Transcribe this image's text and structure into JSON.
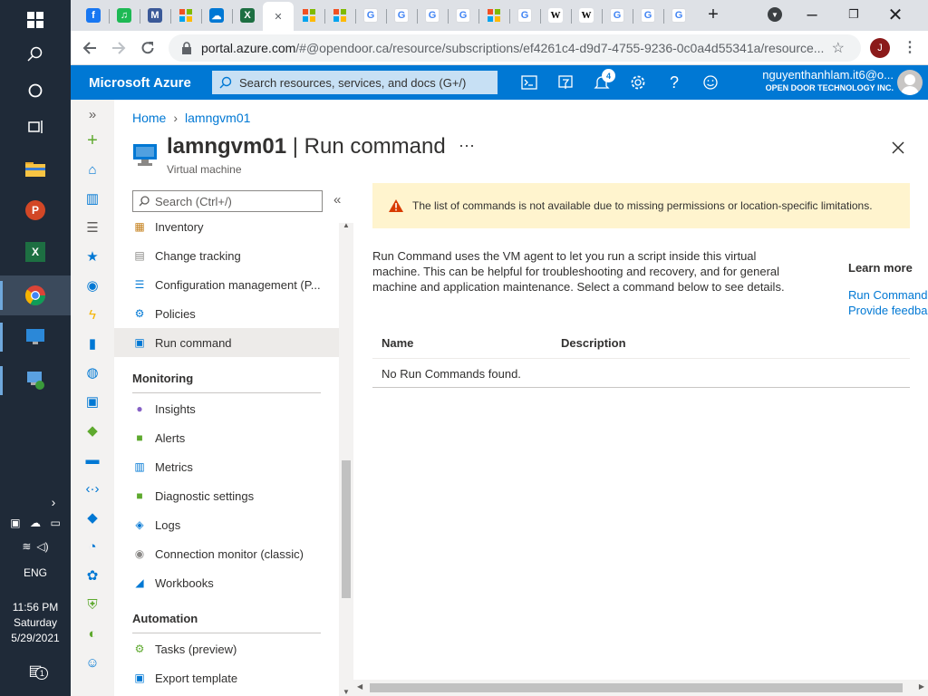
{
  "taskbar": {
    "time": "11:56 PM",
    "day": "Saturday",
    "date": "5/29/2021",
    "language": "ENG",
    "notification_count": "1"
  },
  "browser": {
    "url_host": "portal.azure.com",
    "url_rest": "/#@opendoor.ca/resource/subscriptions/ef4261c4-d9d7-4755-9236-0c0a4d55341a/resource...",
    "profile_initial": "J",
    "tabs": [
      {
        "icon": "facebook-icon",
        "letter": "f",
        "color": "#1877f2"
      },
      {
        "icon": "spotify-icon",
        "letter": "♫",
        "color": "#1db954"
      },
      {
        "icon": "m-icon",
        "letter": "M",
        "color": "#3b5998"
      },
      {
        "icon": "microsoft-icon",
        "letter": "",
        "color": "#f25022"
      },
      {
        "icon": "onedrive-icon",
        "letter": "☁",
        "color": "#0078d4"
      },
      {
        "icon": "excel-icon",
        "letter": "X",
        "color": "#1d6f42"
      },
      {
        "icon": "close-icon",
        "letter": "✕",
        "color": "#5f6368"
      },
      {
        "icon": "microsoft-icon",
        "letter": "",
        "color": "#f25022"
      },
      {
        "icon": "microsoft-icon",
        "letter": "",
        "color": "#f25022"
      },
      {
        "icon": "google-icon",
        "letter": "G",
        "color": "#4285f4"
      },
      {
        "icon": "google-icon",
        "letter": "G",
        "color": "#4285f4"
      },
      {
        "icon": "google-icon",
        "letter": "G",
        "color": "#4285f4"
      },
      {
        "icon": "google-icon",
        "letter": "G",
        "color": "#4285f4"
      },
      {
        "icon": "microsoft-icon",
        "letter": "",
        "color": "#f25022"
      },
      {
        "icon": "google-icon",
        "letter": "G",
        "color": "#4285f4"
      },
      {
        "icon": "wikipedia-icon",
        "letter": "W",
        "color": "#000000"
      },
      {
        "icon": "wikipedia-icon",
        "letter": "W",
        "color": "#000000"
      },
      {
        "icon": "google-icon",
        "letter": "G",
        "color": "#4285f4"
      },
      {
        "icon": "google-icon",
        "letter": "G",
        "color": "#4285f4"
      },
      {
        "icon": "google-icon",
        "letter": "G",
        "color": "#4285f4"
      }
    ]
  },
  "azure": {
    "brand": "Microsoft Azure",
    "search_placeholder": "Search resources, services, and docs (G+/)",
    "notifications": "4",
    "user_email": "nguyenthanhlam.it6@o...",
    "user_org": "OPEN DOOR TECHNOLOGY INC.",
    "accent": "#0078d4"
  },
  "breadcrumb": [
    "Home",
    "lamngvm01"
  ],
  "resource": {
    "name": "lamngvm01",
    "separator": " | ",
    "blade": "Run command",
    "type": "Virtual machine",
    "more": "···"
  },
  "menu": {
    "search_placeholder": "Search (Ctrl+/)",
    "items": [
      {
        "label": "Inventory",
        "icon": "inventory-icon",
        "glyph": "▦",
        "color": "#c47f1a"
      },
      {
        "label": "Change tracking",
        "icon": "change-tracking-icon",
        "glyph": "▤",
        "color": "#8a8886"
      },
      {
        "label": "Configuration management (P...",
        "icon": "configuration-icon",
        "glyph": "☰",
        "color": "#0078d4"
      },
      {
        "label": "Policies",
        "icon": "policies-icon",
        "glyph": "⚙",
        "color": "#0078d4"
      },
      {
        "label": "Run command",
        "icon": "run-command-icon",
        "glyph": "▣",
        "color": "#0078d4"
      }
    ],
    "monitoring_header": "Monitoring",
    "monitoring": [
      {
        "label": "Insights",
        "icon": "insights-icon",
        "glyph": "●",
        "color": "#8661c5"
      },
      {
        "label": "Alerts",
        "icon": "alerts-icon",
        "glyph": "■",
        "color": "#5ea92e"
      },
      {
        "label": "Metrics",
        "icon": "metrics-icon",
        "glyph": "▥",
        "color": "#0078d4"
      },
      {
        "label": "Diagnostic settings",
        "icon": "diagnostic-settings-icon",
        "glyph": "■",
        "color": "#5ea92e"
      },
      {
        "label": "Logs",
        "icon": "logs-icon",
        "glyph": "◈",
        "color": "#0078d4"
      },
      {
        "label": "Connection monitor (classic)",
        "icon": "connection-monitor-icon",
        "glyph": "◉",
        "color": "#8a8886"
      },
      {
        "label": "Workbooks",
        "icon": "workbooks-icon",
        "glyph": "◢",
        "color": "#0078d4"
      }
    ],
    "automation_header": "Automation",
    "automation": [
      {
        "label": "Tasks (preview)",
        "icon": "tasks-icon",
        "glyph": "⚙",
        "color": "#5ea92e"
      },
      {
        "label": "Export template",
        "icon": "export-template-icon",
        "glyph": "▣",
        "color": "#0078d4"
      }
    ]
  },
  "content": {
    "warning": "The list of commands is not available due to missing permissions or location-specific limitations.",
    "description": "Run Command uses the VM agent to let you run a script inside this virtual machine. This can be helpful for troubleshooting and recovery, and for general machine and application maintenance. Select a command below to see details.",
    "learn_more": "Learn more",
    "link1": "Run Command",
    "link2": "Provide feedbac",
    "col_name": "Name",
    "col_description": "Description",
    "empty": "No Run Commands found."
  }
}
